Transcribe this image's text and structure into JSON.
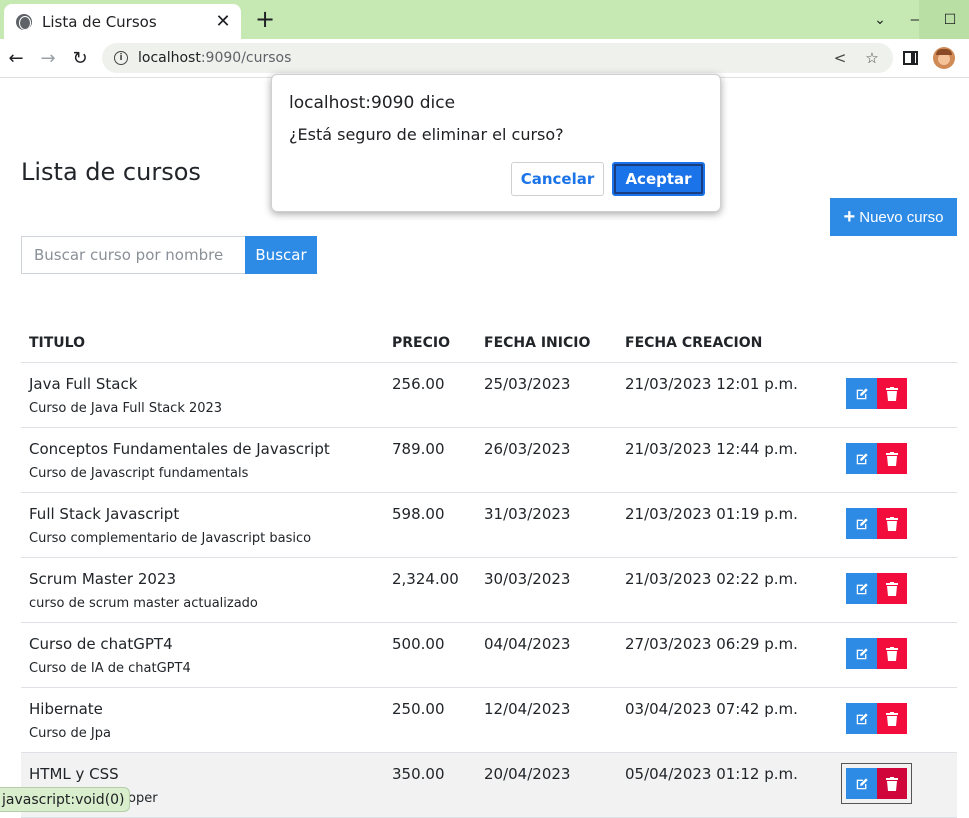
{
  "browser": {
    "tab_title": "Lista de Cursos",
    "url_host": "localhost",
    "url_rest": ":9090/cursos"
  },
  "page": {
    "title": "Lista de cursos",
    "new_course_label": "Nuevo curso",
    "search_placeholder": "Buscar curso por nombre",
    "search_button": "Buscar"
  },
  "table": {
    "headers": [
      "TITULO",
      "PRECIO",
      "FECHA INICIO",
      "FECHA CREACION"
    ],
    "rows": [
      {
        "title": "Java Full Stack",
        "desc": "Curso de Java Full Stack 2023",
        "price": "256.00",
        "start": "25/03/2023",
        "created": "21/03/2023 12:01 p.m."
      },
      {
        "title": "Conceptos Fundamentales de Javascript",
        "desc": "Curso de Javascript fundamentals",
        "price": "789.00",
        "start": "26/03/2023",
        "created": "21/03/2023 12:44 p.m."
      },
      {
        "title": "Full Stack Javascript",
        "desc": "Curso complementario de Javascript basico",
        "price": "598.00",
        "start": "31/03/2023",
        "created": "21/03/2023 01:19 p.m."
      },
      {
        "title": "Scrum Master 2023",
        "desc": "curso de scrum master actualizado",
        "price": "2,324.00",
        "start": "30/03/2023",
        "created": "21/03/2023 02:22 p.m."
      },
      {
        "title": "Curso de chatGPT4",
        "desc": "Curso de IA de chatGPT4",
        "price": "500.00",
        "start": "04/04/2023",
        "created": "27/03/2023 06:29 p.m."
      },
      {
        "title": "Hibernate",
        "desc": "Curso de Jpa",
        "price": "250.00",
        "start": "12/04/2023",
        "created": "03/04/2023 07:42 p.m."
      },
      {
        "title": "HTML y CSS",
        "desc": "FrontEnd Developer",
        "price": "350.00",
        "start": "20/04/2023",
        "created": "05/04/2023 01:12 p.m."
      }
    ]
  },
  "status_bar": "javascript:void(0)",
  "dialog": {
    "title": "localhost:9090 dice",
    "message": "¿Está seguro de eliminar el curso?",
    "cancel": "Cancelar",
    "ok": "Aceptar"
  },
  "colors": {
    "primary": "#2d8be6",
    "danger": "#f20d3c",
    "chrome": "#c6e9b4"
  }
}
